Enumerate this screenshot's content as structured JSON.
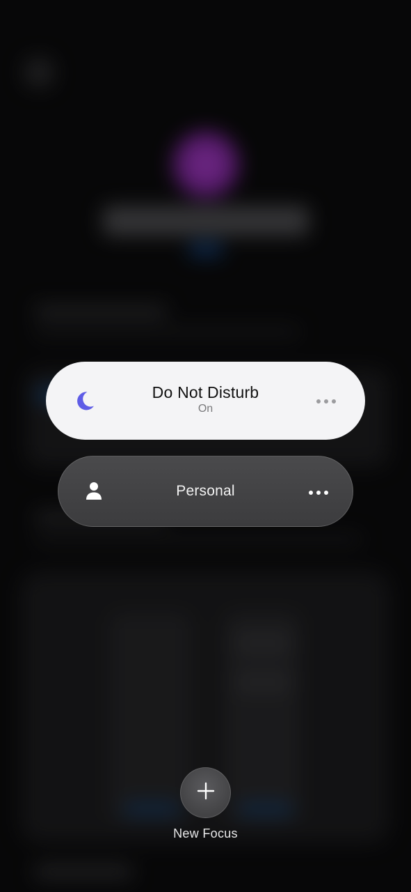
{
  "focus_modes": [
    {
      "name": "Do Not Disturb",
      "status": "On",
      "icon": "moon-icon",
      "icon_color": "#5e5ce6",
      "active": true
    },
    {
      "name": "Personal",
      "status": "",
      "icon": "person-icon",
      "icon_color": "#ffffff",
      "active": false
    }
  ],
  "new_focus": {
    "label": "New Focus",
    "icon": "plus-icon"
  },
  "colors": {
    "active_pill": "#f4f4f6",
    "inactive_pill": "#434345",
    "background": "#0b0b0c"
  }
}
